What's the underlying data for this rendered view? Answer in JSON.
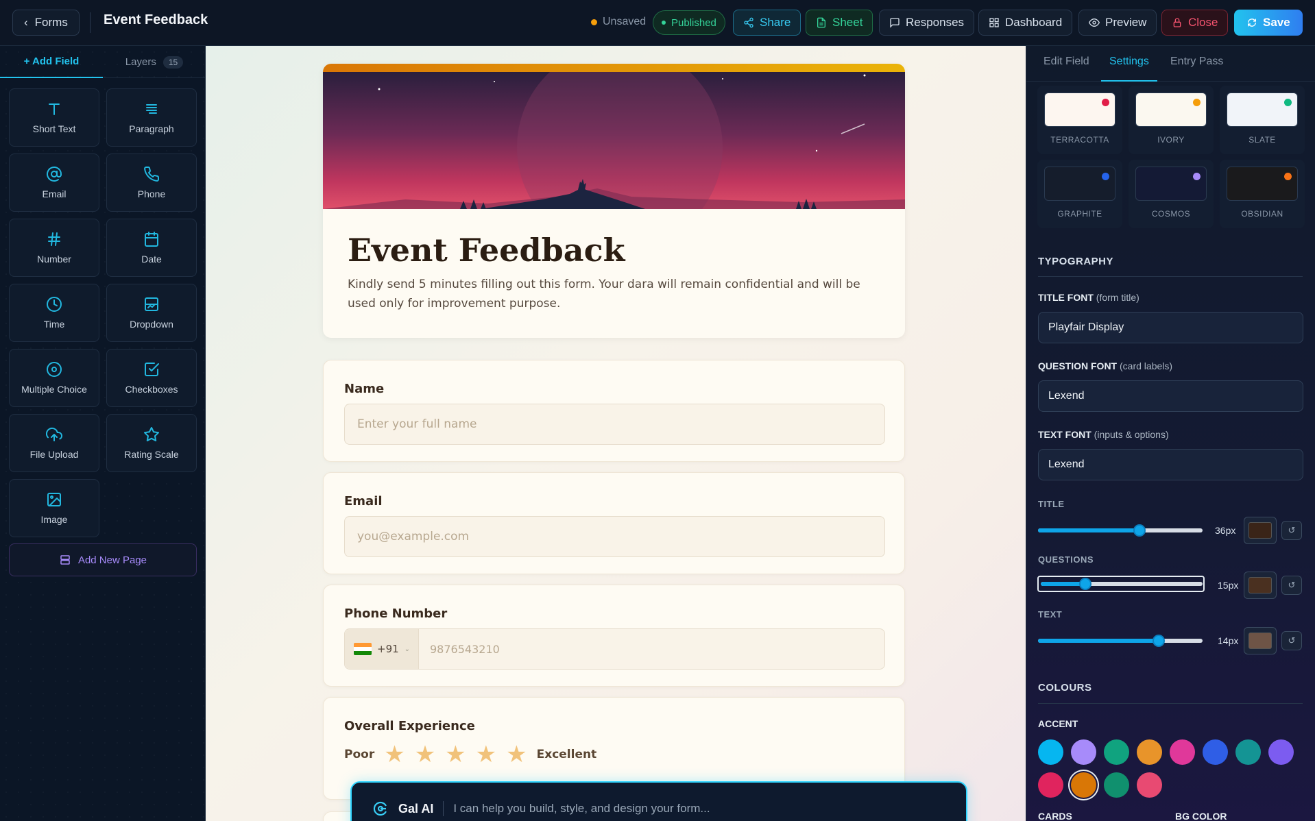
{
  "topbar": {
    "back_label": "Forms",
    "title": "Event Feedback",
    "status_unsaved": "Unsaved",
    "status_published": "Published",
    "buttons": {
      "share": "Share",
      "sheet": "Sheet",
      "responses": "Responses",
      "dashboard": "Dashboard",
      "preview": "Preview",
      "close": "Close",
      "save": "Save"
    }
  },
  "left": {
    "tab_add": "+ Add Field",
    "tab_layers": "Layers",
    "layers_count": "15",
    "fields": [
      "Short Text",
      "Paragraph",
      "Email",
      "Phone",
      "Number",
      "Date",
      "Time",
      "Dropdown",
      "Multiple Choice",
      "Checkboxes",
      "File Upload",
      "Rating Scale",
      "Image"
    ],
    "add_page": "Add New Page"
  },
  "form": {
    "title": "Event Feedback",
    "description": "Kindly send 5 minutes filling out this form. Your dara will remain confidential and will be used only for improvement purpose.",
    "q_name": "Name",
    "q_name_placeholder": "Enter your full name",
    "q_email": "Email",
    "q_email_placeholder": "you@example.com",
    "q_phone": "Phone Number",
    "phone_code": "+91",
    "phone_placeholder": "9876543210",
    "q_rating": "Overall Experience",
    "rating_low": "Poor",
    "rating_high": "Excellent",
    "rating_max": 5
  },
  "ai": {
    "name": "Gal AI",
    "placeholder": "I can help you build, style, and design your form..."
  },
  "right": {
    "tabs": [
      "Edit Field",
      "Settings",
      "Entry Pass"
    ],
    "themes": [
      {
        "name": "TERRACOTTA",
        "bg": "#fdf6f0",
        "dot": "#e11d48"
      },
      {
        "name": "IVORY",
        "bg": "#fbf8f0",
        "dot": "#f59e0b"
      },
      {
        "name": "SLATE",
        "bg": "#f1f4f9",
        "dot": "#10b981"
      },
      {
        "name": "GRAPHITE",
        "bg": "#151d2c",
        "dot": "#2563eb"
      },
      {
        "name": "COSMOS",
        "bg": "#141a35",
        "dot": "#a78bfa"
      },
      {
        "name": "OBSIDIAN",
        "bg": "#1a1a1c",
        "dot": "#f97316"
      }
    ],
    "typography_head": "TYPOGRAPHY",
    "title_font_label": "TITLE FONT",
    "title_font_hint": "(form title)",
    "title_font": "Playfair Display",
    "question_font_label": "QUESTION FONT",
    "question_font_hint": "(card labels)",
    "question_font": "Lexend",
    "text_font_label": "TEXT FONT",
    "text_font_hint": "(inputs & options)",
    "text_font": "Lexend",
    "size_title_label": "TITLE",
    "size_title_val": "36px",
    "size_title_color": "#3a2418",
    "size_questions_label": "QUESTIONS",
    "size_questions_val": "15px",
    "size_questions_color": "#4a3020",
    "size_text_label": "TEXT",
    "size_text_val": "14px",
    "size_text_color": "#6e5446",
    "colours_head": "COLOURS",
    "accent_label": "ACCENT",
    "accents": [
      "#06b6f0",
      "#a78bfa",
      "#10a37f",
      "#e8942a",
      "#e0389a",
      "#2f5ee6",
      "#149494",
      "#7c5cf0",
      "#e0245e",
      "#d97706",
      "#10906e",
      "#e84a72"
    ],
    "accent_selected": 9,
    "cards_label": "CARDS",
    "bg_color_label": "BG COLOR"
  }
}
